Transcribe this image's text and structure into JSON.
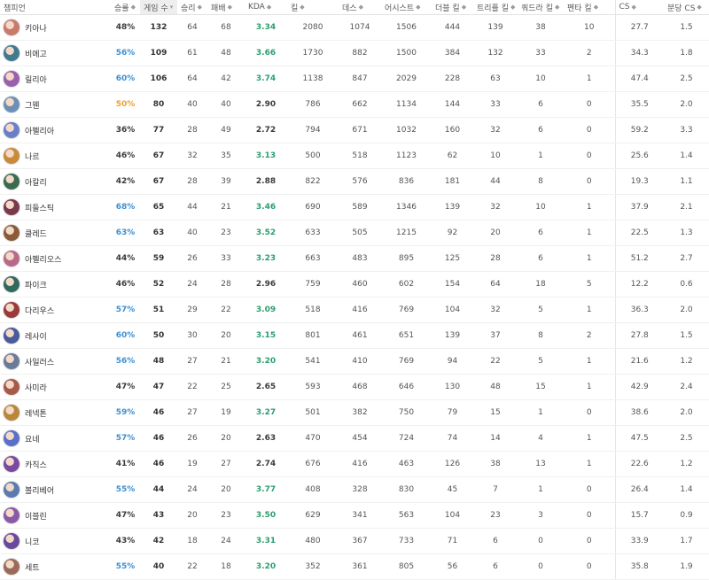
{
  "table": {
    "columns": [
      {
        "key": "champion",
        "label": "챔피언",
        "sort": false
      },
      {
        "key": "winrate",
        "label": "승률",
        "sort": true,
        "active": false,
        "icon": "sort-both-icon"
      },
      {
        "key": "games",
        "label": "게임 수",
        "sort": true,
        "active": true,
        "icon": "sort-desc-icon"
      },
      {
        "key": "wins",
        "label": "승리",
        "sort": true,
        "icon": "sort-both-icon"
      },
      {
        "key": "losses",
        "label": "패배",
        "sort": true,
        "icon": "sort-both-icon"
      },
      {
        "key": "kda",
        "label": "KDA",
        "sort": true,
        "icon": "sort-both-icon"
      },
      {
        "key": "kills",
        "label": "킬",
        "sort": true,
        "icon": "sort-both-icon"
      },
      {
        "key": "deaths",
        "label": "데스",
        "sort": true,
        "icon": "sort-both-icon"
      },
      {
        "key": "assists",
        "label": "어시스트",
        "sort": true,
        "icon": "sort-both-icon"
      },
      {
        "key": "double",
        "label": "더블 킬",
        "sort": true,
        "icon": "sort-both-icon"
      },
      {
        "key": "triple",
        "label": "트리플 킬",
        "sort": true,
        "icon": "sort-both-icon"
      },
      {
        "key": "quadra",
        "label": "쿼드라 킬",
        "sort": true,
        "icon": "sort-both-icon"
      },
      {
        "key": "penta",
        "label": "펜타 킬",
        "sort": true,
        "icon": "sort-both-icon"
      },
      {
        "key": "cs",
        "label": "CS",
        "sort": true,
        "icon": "sort-both-icon"
      },
      {
        "key": "cspm",
        "label": "분당 CS",
        "sort": true,
        "icon": "sort-both-icon"
      }
    ],
    "rows": [
      {
        "champion": "키아나",
        "winrate": "48%",
        "games": "132",
        "wins": "64",
        "losses": "68",
        "kda": "3.34",
        "kills": "2080",
        "deaths": "1074",
        "assists": "1506",
        "double": "444",
        "triple": "139",
        "quadra": "38",
        "penta": "10",
        "cs": "27.7",
        "cspm": "1.5",
        "avatar_color": "#c97a6a"
      },
      {
        "champion": "비에고",
        "winrate": "56%",
        "games": "109",
        "wins": "61",
        "losses": "48",
        "kda": "3.66",
        "kills": "1730",
        "deaths": "882",
        "assists": "1500",
        "double": "384",
        "triple": "132",
        "quadra": "33",
        "penta": "2",
        "cs": "34.3",
        "cspm": "1.8",
        "avatar_color": "#3f7a8f"
      },
      {
        "champion": "릴리아",
        "winrate": "60%",
        "games": "106",
        "wins": "64",
        "losses": "42",
        "kda": "3.74",
        "kills": "1138",
        "deaths": "847",
        "assists": "2029",
        "double": "228",
        "triple": "63",
        "quadra": "10",
        "penta": "1",
        "cs": "47.4",
        "cspm": "2.5",
        "avatar_color": "#9b5fb0"
      },
      {
        "champion": "그웬",
        "winrate": "50%",
        "games": "80",
        "wins": "40",
        "losses": "40",
        "kda": "2.90",
        "kills": "786",
        "deaths": "662",
        "assists": "1134",
        "double": "144",
        "triple": "33",
        "quadra": "6",
        "penta": "0",
        "cs": "35.5",
        "cspm": "2.0",
        "avatar_color": "#6e8fb5"
      },
      {
        "champion": "아펠리아",
        "winrate": "36%",
        "games": "77",
        "wins": "28",
        "losses": "49",
        "kda": "2.72",
        "kills": "794",
        "deaths": "671",
        "assists": "1032",
        "double": "160",
        "triple": "32",
        "quadra": "6",
        "penta": "0",
        "cs": "59.2",
        "cspm": "3.3",
        "avatar_color": "#6a7fc9"
      },
      {
        "champion": "나르",
        "winrate": "46%",
        "games": "67",
        "wins": "32",
        "losses": "35",
        "kda": "3.13",
        "kills": "500",
        "deaths": "518",
        "assists": "1123",
        "double": "62",
        "triple": "10",
        "quadra": "1",
        "penta": "0",
        "cs": "25.6",
        "cspm": "1.4",
        "avatar_color": "#c98a3a"
      },
      {
        "champion": "아칼리",
        "winrate": "42%",
        "games": "67",
        "wins": "28",
        "losses": "39",
        "kda": "2.88",
        "kills": "822",
        "deaths": "576",
        "assists": "836",
        "double": "181",
        "triple": "44",
        "quadra": "8",
        "penta": "0",
        "cs": "19.3",
        "cspm": "1.1",
        "avatar_color": "#3a6a4f"
      },
      {
        "champion": "피들스틱",
        "winrate": "68%",
        "games": "65",
        "wins": "44",
        "losses": "21",
        "kda": "3.46",
        "kills": "690",
        "deaths": "589",
        "assists": "1346",
        "double": "139",
        "triple": "32",
        "quadra": "10",
        "penta": "1",
        "cs": "37.9",
        "cspm": "2.1",
        "avatar_color": "#7a3a4a"
      },
      {
        "champion": "클레드",
        "winrate": "63%",
        "games": "63",
        "wins": "40",
        "losses": "23",
        "kda": "3.52",
        "kills": "633",
        "deaths": "505",
        "assists": "1215",
        "double": "92",
        "triple": "20",
        "quadra": "6",
        "penta": "1",
        "cs": "22.5",
        "cspm": "1.3",
        "avatar_color": "#8a5a3a"
      },
      {
        "champion": "아펠리오스",
        "winrate": "44%",
        "games": "59",
        "wins": "26",
        "losses": "33",
        "kda": "3.23",
        "kills": "663",
        "deaths": "483",
        "assists": "895",
        "double": "125",
        "triple": "28",
        "quadra": "6",
        "penta": "1",
        "cs": "51.2",
        "cspm": "2.7",
        "avatar_color": "#b96a8a"
      },
      {
        "champion": "파이크",
        "winrate": "46%",
        "games": "52",
        "wins": "24",
        "losses": "28",
        "kda": "2.96",
        "kills": "759",
        "deaths": "460",
        "assists": "602",
        "double": "154",
        "triple": "64",
        "quadra": "18",
        "penta": "5",
        "cs": "12.2",
        "cspm": "0.6",
        "avatar_color": "#2f6a5f"
      },
      {
        "champion": "다리우스",
        "winrate": "57%",
        "games": "51",
        "wins": "29",
        "losses": "22",
        "kda": "3.09",
        "kills": "518",
        "deaths": "416",
        "assists": "769",
        "double": "104",
        "triple": "32",
        "quadra": "5",
        "penta": "1",
        "cs": "36.3",
        "cspm": "2.0",
        "avatar_color": "#9a3a3a"
      },
      {
        "champion": "레사이",
        "winrate": "60%",
        "games": "50",
        "wins": "30",
        "losses": "20",
        "kda": "3.15",
        "kills": "801",
        "deaths": "461",
        "assists": "651",
        "double": "139",
        "triple": "37",
        "quadra": "8",
        "penta": "2",
        "cs": "27.8",
        "cspm": "1.5",
        "avatar_color": "#4a5a9a"
      },
      {
        "champion": "사일러스",
        "winrate": "56%",
        "games": "48",
        "wins": "27",
        "losses": "21",
        "kda": "3.20",
        "kills": "541",
        "deaths": "410",
        "assists": "769",
        "double": "94",
        "triple": "22",
        "quadra": "5",
        "penta": "1",
        "cs": "21.6",
        "cspm": "1.2",
        "avatar_color": "#6a7a9a"
      },
      {
        "champion": "사미라",
        "winrate": "47%",
        "games": "47",
        "wins": "22",
        "losses": "25",
        "kda": "2.65",
        "kills": "593",
        "deaths": "468",
        "assists": "646",
        "double": "130",
        "triple": "48",
        "quadra": "15",
        "penta": "1",
        "cs": "42.9",
        "cspm": "2.4",
        "avatar_color": "#a85a4a"
      },
      {
        "champion": "레넥톤",
        "winrate": "59%",
        "games": "46",
        "wins": "27",
        "losses": "19",
        "kda": "3.27",
        "kills": "501",
        "deaths": "382",
        "assists": "750",
        "double": "79",
        "triple": "15",
        "quadra": "1",
        "penta": "0",
        "cs": "38.6",
        "cspm": "2.0",
        "avatar_color": "#b9863a"
      },
      {
        "champion": "요네",
        "winrate": "57%",
        "games": "46",
        "wins": "26",
        "losses": "20",
        "kda": "2.63",
        "kills": "470",
        "deaths": "454",
        "assists": "724",
        "double": "74",
        "triple": "14",
        "quadra": "4",
        "penta": "1",
        "cs": "47.5",
        "cspm": "2.5",
        "avatar_color": "#5a6fc9"
      },
      {
        "champion": "카직스",
        "winrate": "41%",
        "games": "46",
        "wins": "19",
        "losses": "27",
        "kda": "2.74",
        "kills": "676",
        "deaths": "416",
        "assists": "463",
        "double": "126",
        "triple": "38",
        "quadra": "13",
        "penta": "1",
        "cs": "22.6",
        "cspm": "1.2",
        "avatar_color": "#7a4aa0"
      },
      {
        "champion": "볼리베어",
        "winrate": "55%",
        "games": "44",
        "wins": "24",
        "losses": "20",
        "kda": "3.77",
        "kills": "408",
        "deaths": "328",
        "assists": "830",
        "double": "45",
        "triple": "7",
        "quadra": "1",
        "penta": "0",
        "cs": "26.4",
        "cspm": "1.4",
        "avatar_color": "#5a7ab0"
      },
      {
        "champion": "이블린",
        "winrate": "47%",
        "games": "43",
        "wins": "20",
        "losses": "23",
        "kda": "3.50",
        "kills": "629",
        "deaths": "341",
        "assists": "563",
        "double": "104",
        "triple": "23",
        "quadra": "3",
        "penta": "0",
        "cs": "15.7",
        "cspm": "0.9",
        "avatar_color": "#8a5aa8"
      },
      {
        "champion": "니코",
        "winrate": "43%",
        "games": "42",
        "wins": "18",
        "losses": "24",
        "kda": "3.31",
        "kills": "480",
        "deaths": "367",
        "assists": "733",
        "double": "71",
        "triple": "6",
        "quadra": "0",
        "penta": "0",
        "cs": "33.9",
        "cspm": "1.7",
        "avatar_color": "#6a4a9a"
      },
      {
        "champion": "세트",
        "winrate": "55%",
        "games": "40",
        "wins": "22",
        "losses": "18",
        "kda": "3.20",
        "kills": "352",
        "deaths": "361",
        "assists": "805",
        "double": "56",
        "triple": "6",
        "quadra": "0",
        "penta": "0",
        "cs": "35.8",
        "cspm": "1.9",
        "avatar_color": "#9a6a5a"
      }
    ]
  },
  "colors": {
    "winrate_high": "#3d8fd0",
    "winrate_even": "#f0a030",
    "winrate_low": "#3a3a3a",
    "kda_good": "#2a9d6e",
    "kda_normal": "#3a3a3a"
  }
}
